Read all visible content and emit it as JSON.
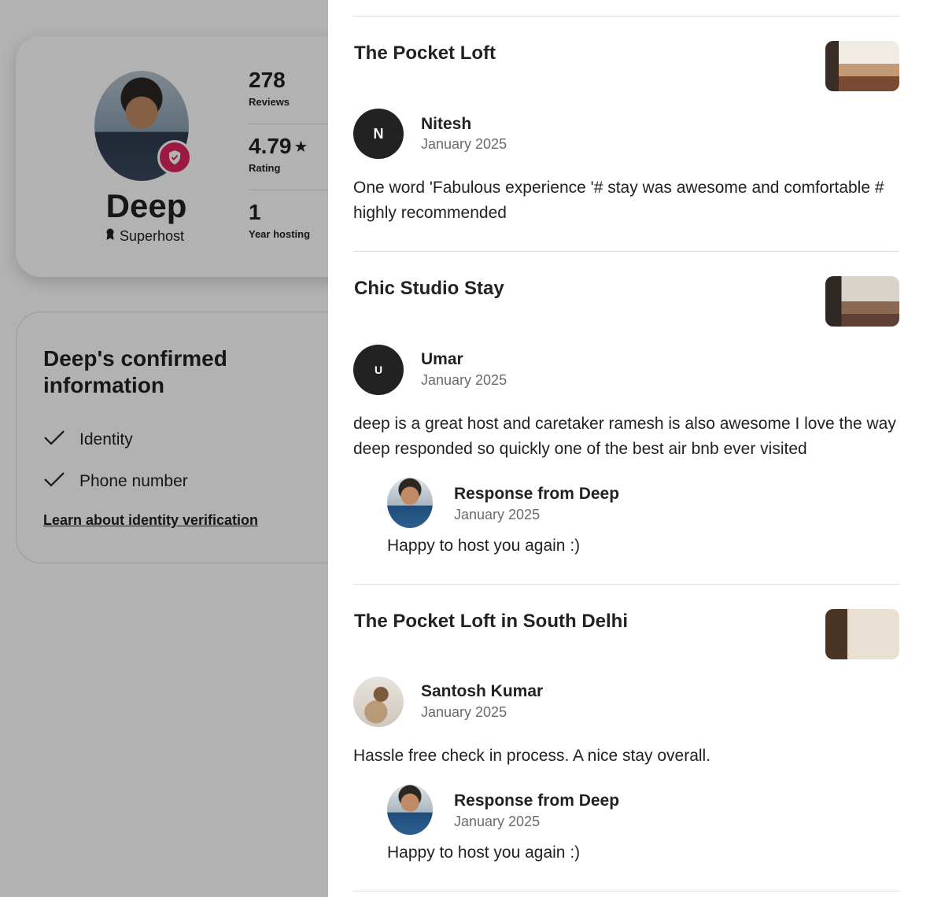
{
  "profile": {
    "name": "Deep",
    "superhost_label": "Superhost",
    "stats": [
      {
        "value": "278",
        "label": "Reviews"
      },
      {
        "value": "4.79",
        "label": "Rating"
      },
      {
        "value": "1",
        "label": "Year hosting"
      }
    ]
  },
  "confirmed": {
    "title": "Deep's confirmed information",
    "items": [
      "Identity",
      "Phone number"
    ],
    "link": "Learn about identity verification"
  },
  "reviews": [
    {
      "listing": "The Pocket Loft",
      "reviewer": "Nitesh",
      "initial": "N",
      "date": "January 2025",
      "text": "One word 'Fabulous experience '# stay was awesome and comfortable # highly recommended"
    },
    {
      "listing": "Chic Studio Stay",
      "reviewer": "Umar",
      "initial": "U",
      "date": "January 2025",
      "text": "deep is a great host and caretaker ramesh is also awesome I love the way deep responded so quickly one of the best air bnb ever visited",
      "response": {
        "title": "Response from Deep",
        "date": "January 2025",
        "text": "Happy to host you again :)"
      }
    },
    {
      "listing": "The Pocket Loft in South Delhi",
      "reviewer": "Santosh Kumar",
      "date": "January 2025",
      "text": "Hassle free check in process. A nice stay overall.",
      "response": {
        "title": "Response from Deep",
        "date": "January 2025",
        "text": "Happy to host you again :)"
      }
    }
  ],
  "colors": {
    "badge": "#e0245e",
    "scrim": "rgba(0,0,0,0.30)"
  }
}
